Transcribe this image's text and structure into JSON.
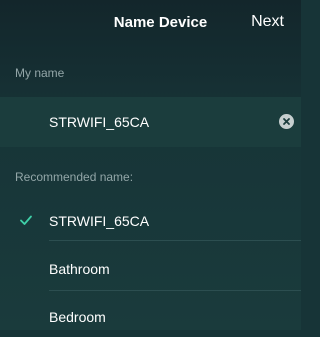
{
  "nav": {
    "title": "Name Device",
    "next_label": "Next"
  },
  "my_name": {
    "section_label": "My name",
    "value": "STRWIFI_65CA"
  },
  "recommended": {
    "section_label": "Recommended name:",
    "items": [
      {
        "label": "STRWIFI_65CA",
        "selected": true
      },
      {
        "label": "Bathroom",
        "selected": false
      },
      {
        "label": "Bedroom",
        "selected": false
      }
    ]
  },
  "icons": {
    "clear": "clear-icon",
    "check": "check-icon"
  },
  "colors": {
    "accent_check": "#3fd0a8"
  }
}
